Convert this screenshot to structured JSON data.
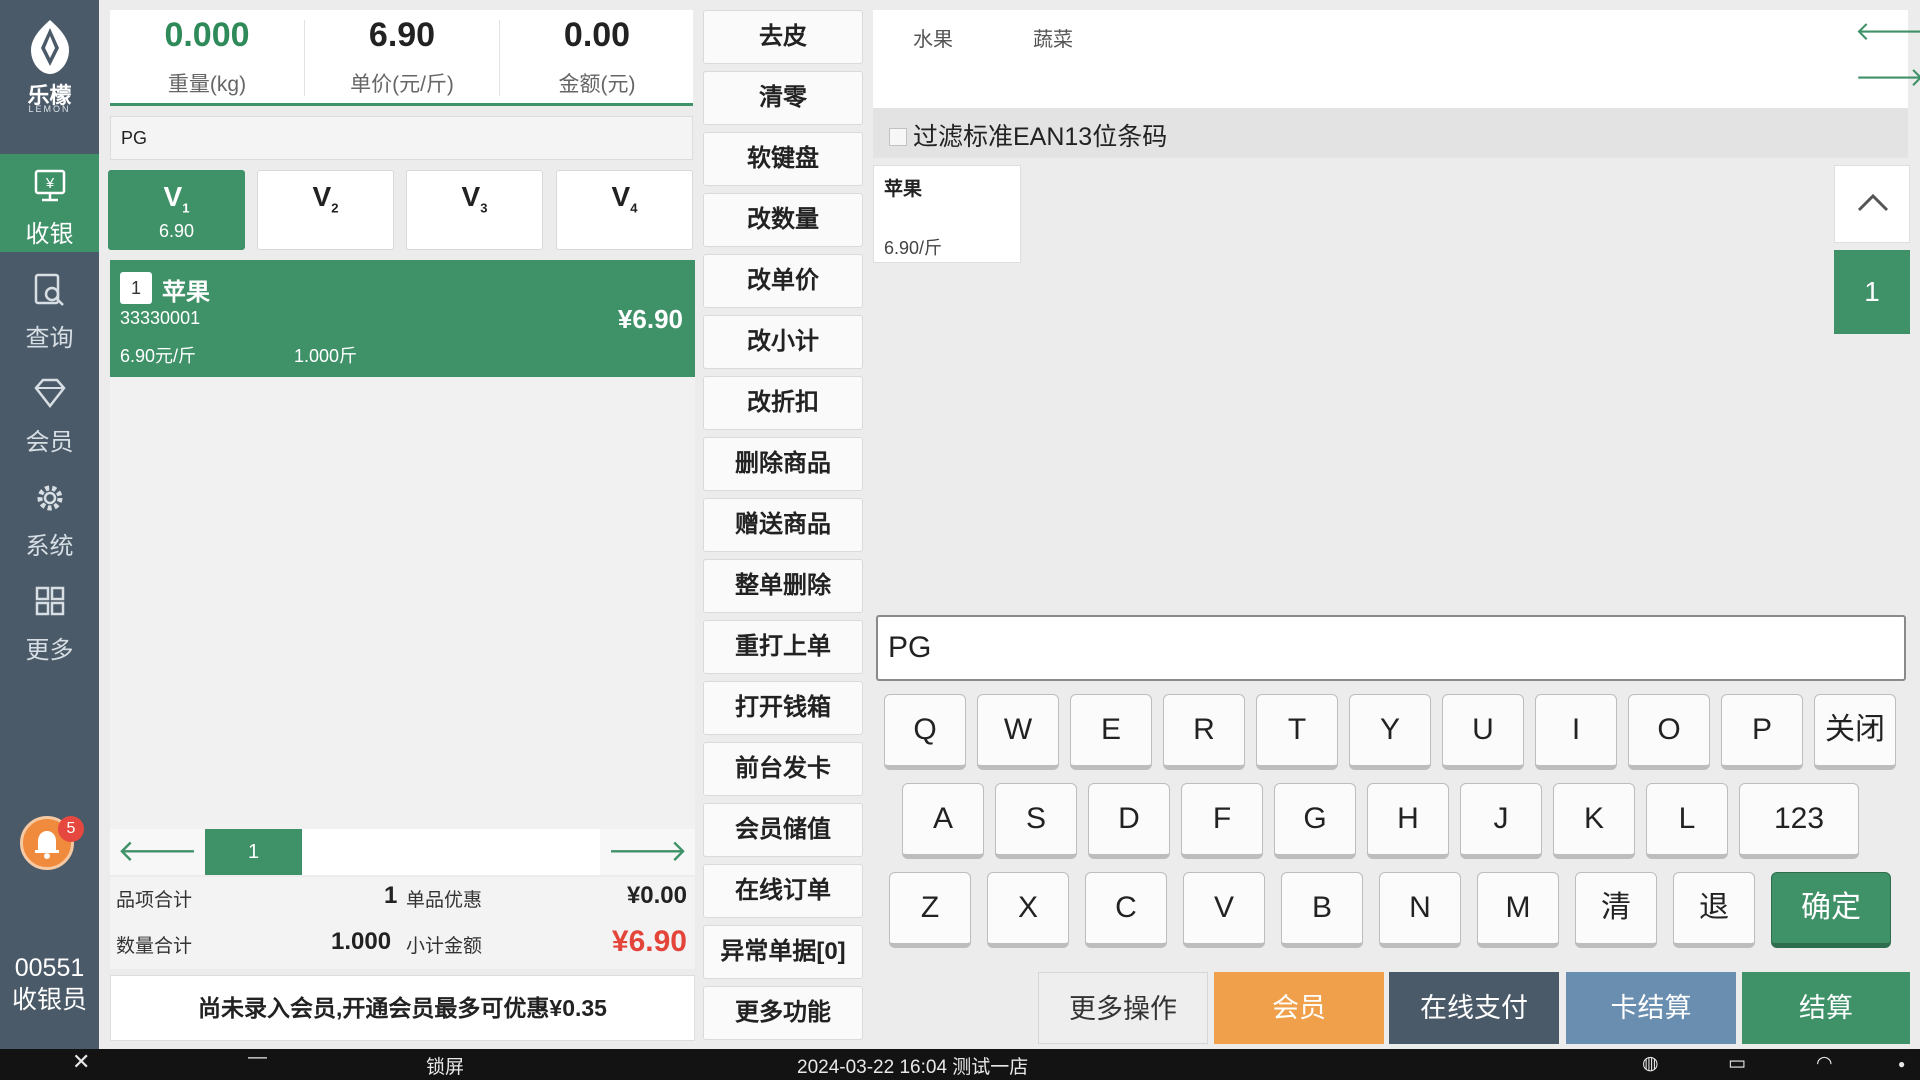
{
  "brand": {
    "name": "乐檬",
    "sub": "LEMON"
  },
  "nav": [
    {
      "label": "收银",
      "icon": "cashier-icon"
    },
    {
      "label": "查询",
      "icon": "search-doc-icon"
    },
    {
      "label": "会员",
      "icon": "diamond-icon"
    },
    {
      "label": "系统",
      "icon": "gear-icon"
    },
    {
      "label": "更多",
      "icon": "grid-icon"
    }
  ],
  "notification": {
    "count": "5"
  },
  "user": {
    "id": "00551",
    "role": "收银员"
  },
  "stats": [
    {
      "value": "0.000",
      "label": "重量(kg)"
    },
    {
      "value": "6.90",
      "label": "单价(元/斤)"
    },
    {
      "value": "0.00",
      "label": "金额(元)"
    }
  ],
  "search": {
    "value": "PG"
  },
  "vip_prices": [
    {
      "tier": "V",
      "sub": "1",
      "price": "6.90"
    },
    {
      "tier": "V",
      "sub": "2",
      "price": ""
    },
    {
      "tier": "V",
      "sub": "3",
      "price": ""
    },
    {
      "tier": "V",
      "sub": "4",
      "price": ""
    }
  ],
  "cart_item": {
    "qty": "1",
    "name": "苹果",
    "code": "33330001",
    "unit_price": "6.90元/斤",
    "weight": "1.000斤",
    "total": "¥6.90"
  },
  "pager": {
    "page": "1",
    "prev": "🡐",
    "next": "🡒"
  },
  "summary": {
    "items_label": "品项合计",
    "items_value": "1",
    "discount_label": "单品优惠",
    "discount_value": "¥0.00",
    "qty_label": "数量合计",
    "qty_value": "1.000",
    "subtotal_label": "小计金额",
    "subtotal_value": "¥6.90"
  },
  "notice": "尚未录入会员,开通会员最多可优惠¥0.35",
  "functions": [
    "去皮",
    "清零",
    "软键盘",
    "改数量",
    "改单价",
    "改小计",
    "改折扣",
    "删除商品",
    "赠送商品",
    "整单删除",
    "重打上单",
    "打开钱箱",
    "前台发卡",
    "会员储值",
    "在线订单",
    "异常单据[0]",
    "更多功能"
  ],
  "categories": [
    "水果",
    "蔬菜"
  ],
  "filter_label": "过滤标准EAN13位条码",
  "product": {
    "name": "苹果",
    "price": "6.90/斤"
  },
  "product_page": "1",
  "keyboard": {
    "input": "PG",
    "row1": [
      "Q",
      "W",
      "E",
      "R",
      "T",
      "Y",
      "U",
      "I",
      "O",
      "P",
      "关闭"
    ],
    "row2": [
      "A",
      "S",
      "D",
      "F",
      "G",
      "H",
      "J",
      "K",
      "L",
      "123"
    ],
    "row3": [
      "Z",
      "X",
      "C",
      "V",
      "B",
      "N",
      "M",
      "清",
      "退",
      "确定"
    ]
  },
  "actions": [
    "更多操作",
    "会员",
    "在线支付",
    "卡结算",
    "结算"
  ],
  "action_colors": [
    "#eeeeee",
    "#f0a04b",
    "#4b5a68",
    "#6a8eb0",
    "#3f9168"
  ],
  "taskbar": {
    "lock": "锁屏",
    "status": "2024-03-22 16:04 测试一店"
  }
}
